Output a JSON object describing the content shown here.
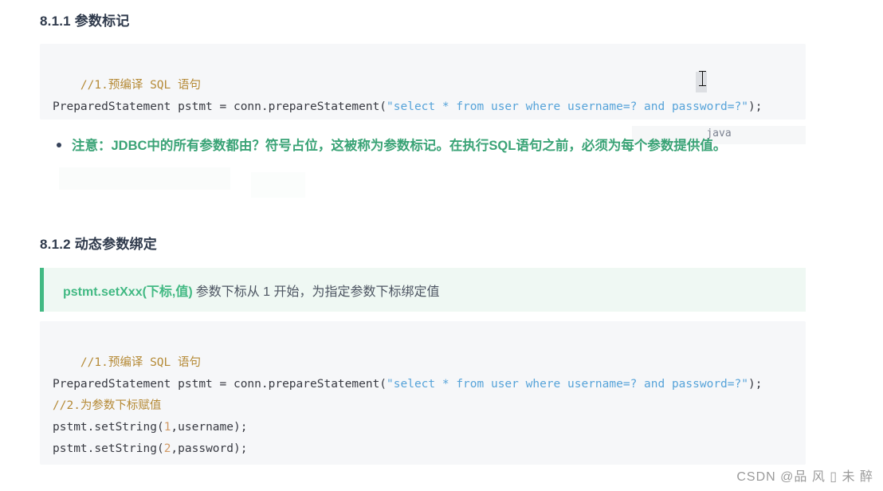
{
  "headings": {
    "h1": "8.1.1 参数标记",
    "h2": "8.1.2 动态参数绑定"
  },
  "code_block_1": {
    "language_badge": "java",
    "lines": [
      {
        "type": "comment",
        "text": "//1.预编译 SQL 语句"
      },
      {
        "type": "code",
        "text": "PreparedStatement pstmt = conn.prepareStatement(\"select * from user where username=? and password=?\");"
      }
    ],
    "full_text": "//1.预编译 SQL 语句\nPreparedStatement pstmt = conn.prepareStatement(\"select * from user where username=? and password=?\");",
    "segments": [
      {
        "cls": "tok-comment",
        "text": "//1.预编译 SQL 语句\n"
      },
      {
        "cls": "tok-plain",
        "text": "PreparedStatement pstmt = conn.prepareStatement("
      },
      {
        "cls": "tok-string",
        "text": "\"select * from user where username=? and password=?\""
      },
      {
        "cls": "tok-punct",
        "text": ");"
      }
    ]
  },
  "bullet_note": {
    "text": "注意：JDBC中的所有参数都由？符号占位，这被称为参数标记。在执行SQL语句之前，必须为每个参数提供值。"
  },
  "callout": {
    "code_label": "pstmt.setXxx(下标,值)",
    "description": "参数下标从 1 开始，为指定参数下标绑定值"
  },
  "code_block_2": {
    "full_text": "//1.预编译 SQL 语句\nPreparedStatement pstmt = conn.prepareStatement(\"select * from user where username=? and password=?\");\n//2.为参数下标赋值\npstmt.setString(1,username);\npstmt.setString(2,password);",
    "segments": [
      {
        "cls": "tok-comment",
        "text": "//1.预编译 SQL 语句\n"
      },
      {
        "cls": "tok-plain",
        "text": "PreparedStatement pstmt = conn.prepareStatement("
      },
      {
        "cls": "tok-string",
        "text": "\"select * from user where username=? and password=?\""
      },
      {
        "cls": "tok-punct",
        "text": ");\n"
      },
      {
        "cls": "tok-comment",
        "text": "//2.为参数下标赋值\n"
      },
      {
        "cls": "tok-plain",
        "text": "pstmt.setString("
      },
      {
        "cls": "tok-number",
        "text": "1"
      },
      {
        "cls": "tok-plain",
        "text": ",username);\n"
      },
      {
        "cls": "tok-plain",
        "text": "pstmt.setString("
      },
      {
        "cls": "tok-number",
        "text": "2"
      },
      {
        "cls": "tok-plain",
        "text": ",password);"
      }
    ]
  },
  "overlay": {
    "language_badge": "java"
  },
  "watermark": {
    "text": "CSDN @品 风 ▯ 未 醉"
  },
  "colors": {
    "heading": "#2f3a4c",
    "code_bg": "#f6f7f9",
    "comment": "#b58a36",
    "string": "#56a3d9",
    "number": "#d19a66",
    "accent_green": "#42b983",
    "note_green": "#3aa376",
    "callout_bg": "#eff8f3",
    "watermark": "#9a9a9a"
  }
}
